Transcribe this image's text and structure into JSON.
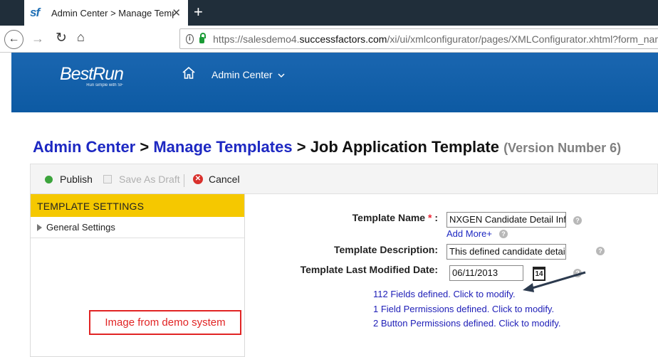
{
  "browser": {
    "tab_title": "Admin Center > Manage Temp",
    "tab_logo": "sf",
    "close_glyph": "✕",
    "new_tab_glyph": "+",
    "url_prefix": "https://salesdemo4.",
    "url_domain": "successfactors.com",
    "url_rest": "/xi/ui/xmlconfigurator/pages/XMLConfigurator.xhtml?form_nam"
  },
  "header": {
    "brand": "BestRun",
    "brand_tagline": "Run simple with SF",
    "admin_menu": "Admin Center"
  },
  "breadcrumb": {
    "item1": "Admin Center",
    "sep": ">",
    "item2": "Manage Templates",
    "current": "Job Application Template",
    "version": "(Version Number 6)"
  },
  "toolbar": {
    "publish": "Publish",
    "save_draft": "Save As Draft",
    "cancel": "Cancel"
  },
  "left_panel": {
    "header": "TEMPLATE SETTINGS",
    "items": [
      "General Settings"
    ]
  },
  "form": {
    "template_name_label": "Template Name",
    "required_mark": "*",
    "colon": ":",
    "template_name_value": "NXGEN Candidate Detail Info",
    "add_more": "Add More+",
    "description_label": "Template Description:",
    "description_value": "This defined candidate detail",
    "modified_label": "Template Last Modified Date:",
    "modified_value": "06/11/2013",
    "calendar_day": "14",
    "help_glyph": "?"
  },
  "links": {
    "fields": "112 Fields defined. Click to modify.",
    "field_permissions": "1 Field Permissions defined. Click to modify.",
    "button_permissions": "2 Button Permissions defined. Click to modify."
  },
  "annotation": {
    "text": "Image from demo system"
  },
  "colors": {
    "header_blue": "#0d5aa3",
    "accent_yellow": "#f5c800",
    "link_blue": "#1d28c2",
    "annotation_red": "#e12424"
  }
}
